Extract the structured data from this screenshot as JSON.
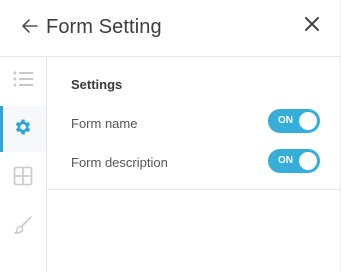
{
  "header": {
    "title": "Form Setting",
    "back_icon": "arrow-left-icon",
    "close_icon": "close-icon"
  },
  "sidebar": {
    "items": [
      {
        "icon": "list-icon",
        "active": false
      },
      {
        "icon": "gear-icon",
        "active": true
      },
      {
        "icon": "grid-icon",
        "active": false
      },
      {
        "icon": "brush-icon",
        "active": false
      }
    ]
  },
  "settings": {
    "section_title": "Settings",
    "rows": [
      {
        "label": "Form name",
        "toggle_text": "ON",
        "on": true
      },
      {
        "label": "Form description",
        "toggle_text": "ON",
        "on": true
      }
    ]
  },
  "colors": {
    "accent": "#35afd9",
    "icon_inactive": "#c9c9c9",
    "text": "#4a4a4a"
  }
}
